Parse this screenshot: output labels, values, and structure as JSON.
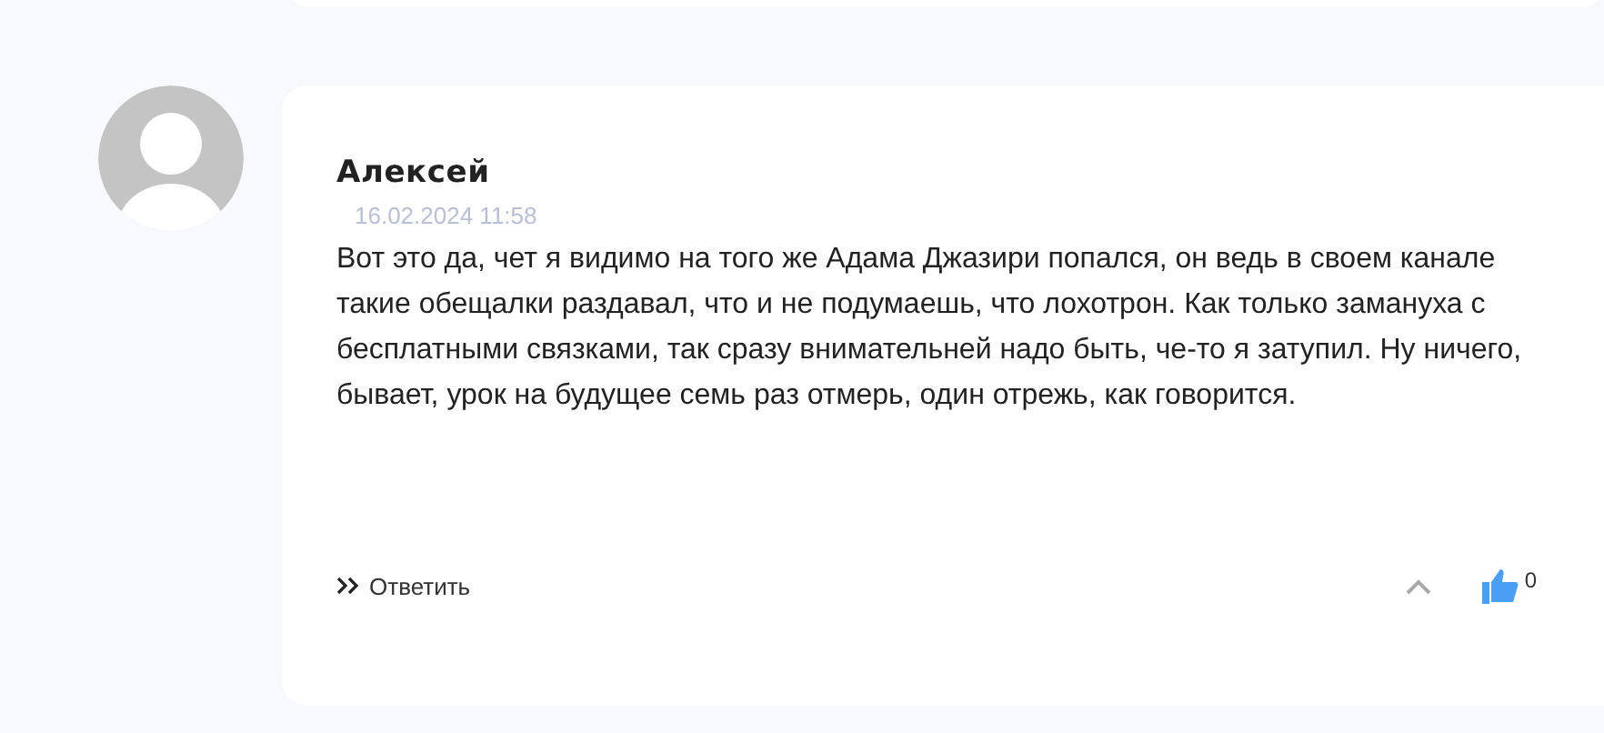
{
  "comment": {
    "author": "Алексей",
    "date": "16.02.2024 11:58",
    "text": "Вот это да, чет я видимо на того же Адама Джазири попался, он ведь в своем канале такие обещалки раздавал, что и не подумаешь, что лохотрон. Как только замануха с бесплатными связками, так сразу внимательней надо быть, че-то я затупил. Ну ничего, бывает, урок на будущее семь раз отмерь, один отрежь, как говорится.",
    "reply_label": "Ответить",
    "likes": "0"
  }
}
